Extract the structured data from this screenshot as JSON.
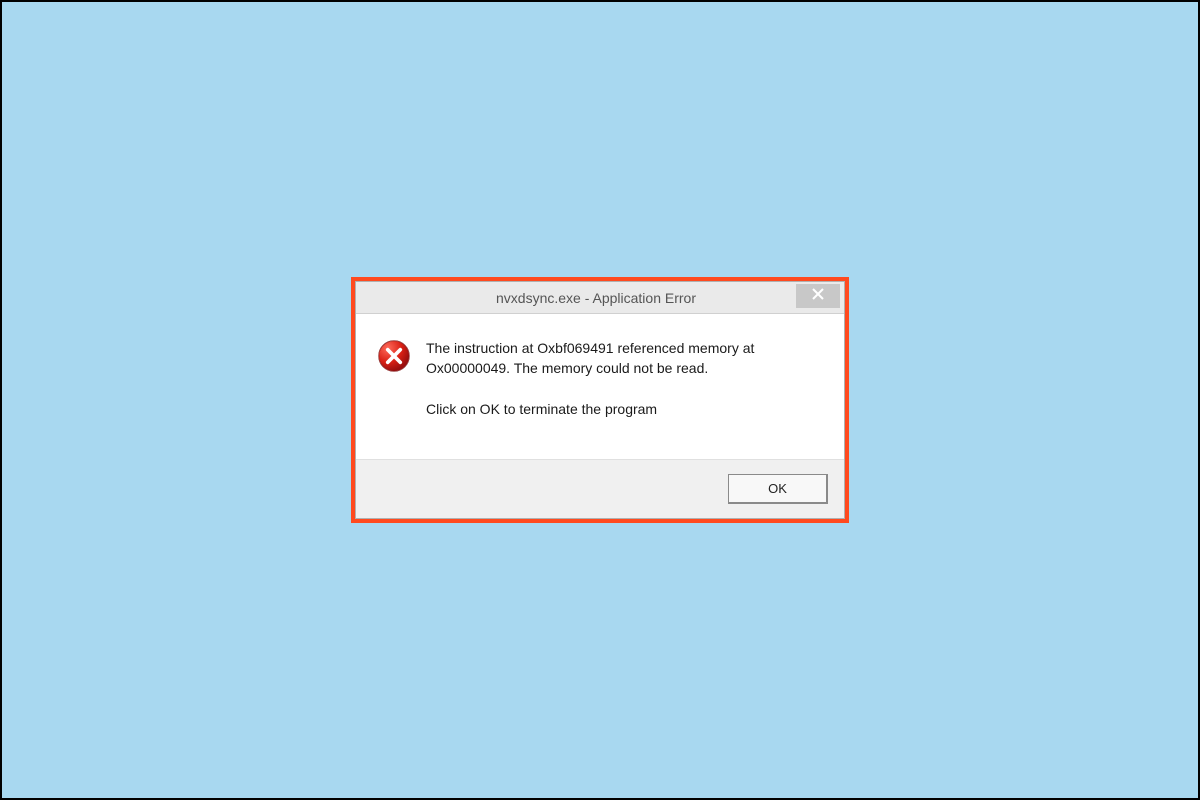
{
  "dialog": {
    "title": "nvxdsync.exe - Application Error",
    "message": "The instruction at Oxbf069491 referenced memory at Ox00000049. The memory could not be read.",
    "instruction": "Click on OK to terminate the program",
    "ok_label": "OK"
  }
}
